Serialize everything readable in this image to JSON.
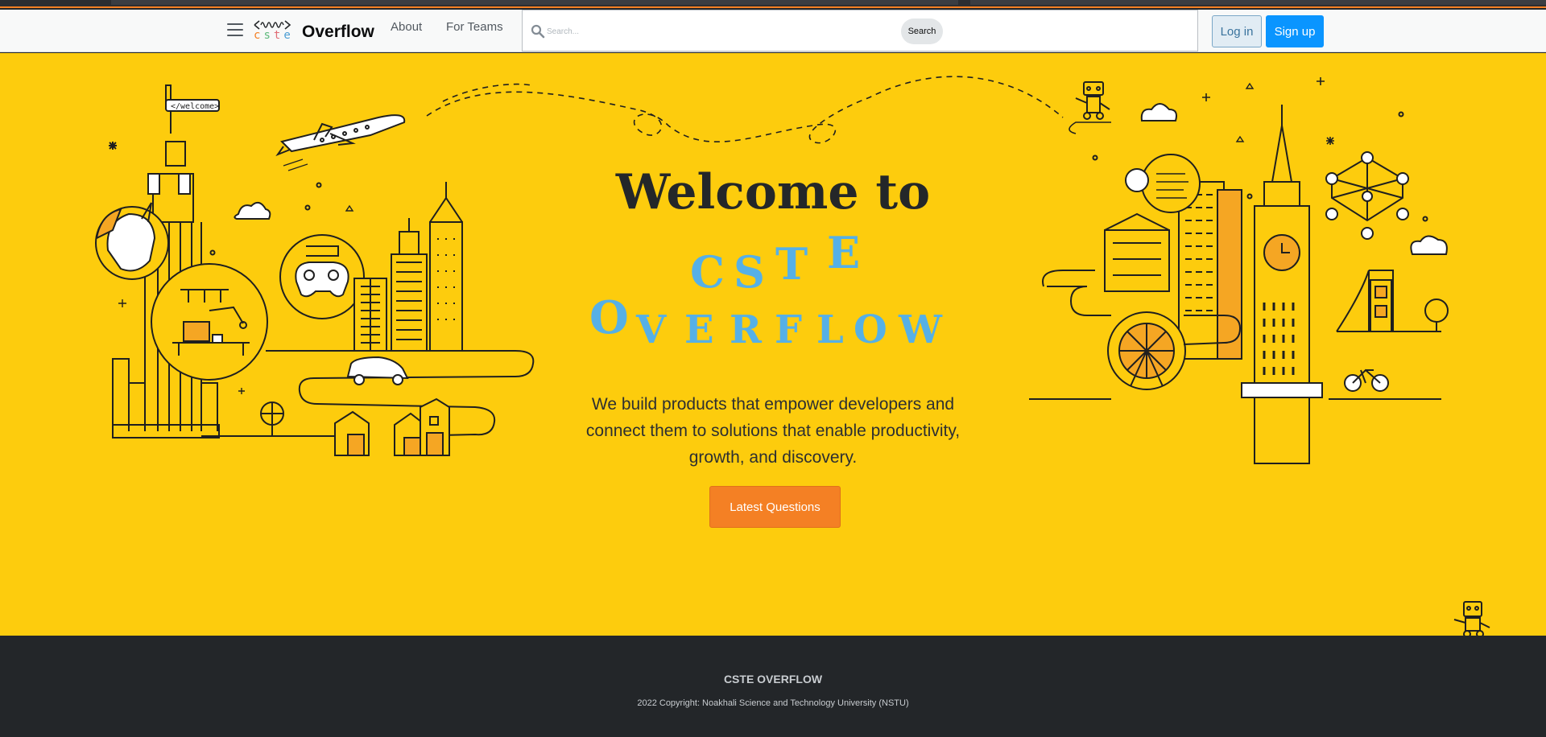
{
  "nav": {
    "brand_mark_letters": "cste",
    "brand_text": "Overflow",
    "links": [
      "About",
      "For Teams"
    ],
    "search_placeholder": "Search...",
    "search_button": "Search",
    "login": "Log in",
    "signup": "Sign up"
  },
  "hero": {
    "headline": "Welcome to",
    "brand_row1": [
      "C",
      "S",
      "T",
      "E"
    ],
    "brand_row2": [
      "O",
      "V",
      "E",
      "R",
      "F",
      "L",
      "O",
      "W"
    ],
    "tagline": "We build products that empower developers and connect them to solutions that enable productivity, growth, and discovery.",
    "cta": "Latest Questions",
    "flag_text": "</welcome>"
  },
  "footer": {
    "title": "CSTE OVERFLOW",
    "copyright": "2022 Copyright: Noakhali Science and Technology University (NSTU)"
  },
  "colors": {
    "hero_bg": "#fdcc0d",
    "brand_blue": "#56b0e6",
    "cta_orange": "#f48024",
    "signup_blue": "#0a95ff",
    "footer_bg": "#232629"
  }
}
